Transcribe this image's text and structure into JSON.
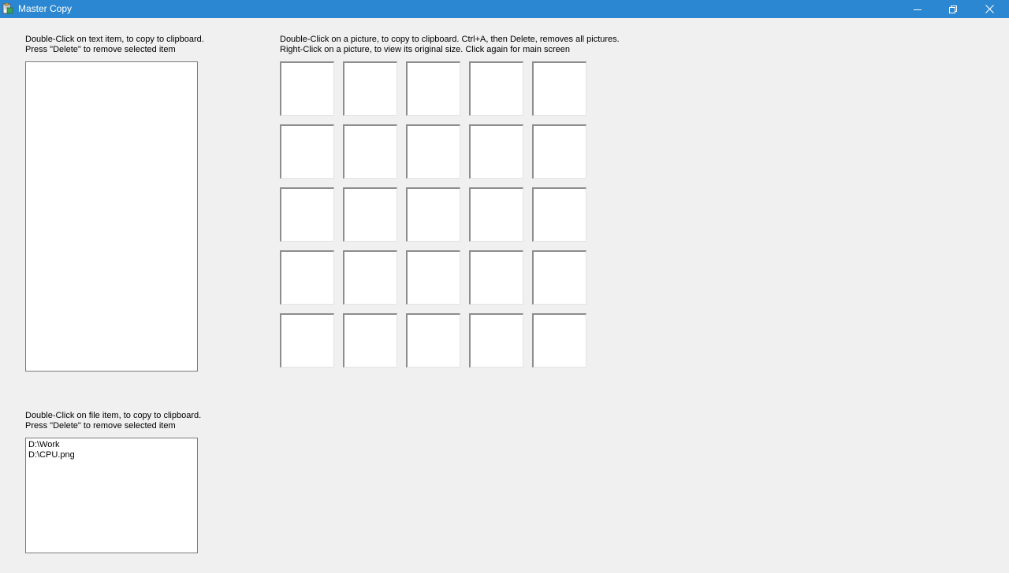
{
  "window": {
    "title": "Master Copy",
    "icon": "clipboard-app-icon",
    "controls": [
      "minimize-icon",
      "restore-icon",
      "close-icon"
    ],
    "titlebar_color": "#2b87d1"
  },
  "text_panel": {
    "caption_line1": "Double-Click on text item, to copy to clipboard.",
    "caption_line2": "Press \"Delete\" to remove selected item",
    "items": []
  },
  "picture_panel": {
    "caption_line1": "Double-Click on a picture, to copy to clipboard.  Ctrl+A, then Delete, removes all pictures.",
    "caption_line2": "Right-Click on a picture, to view its original size. Click again for main screen",
    "rows": 5,
    "columns": 5
  },
  "file_panel": {
    "caption_line1": "Double-Click on file item, to copy to clipboard.",
    "caption_line2": "Press \"Delete\" to remove selected item",
    "items": [
      "D:\\Work",
      "D:\\CPU.png"
    ]
  }
}
